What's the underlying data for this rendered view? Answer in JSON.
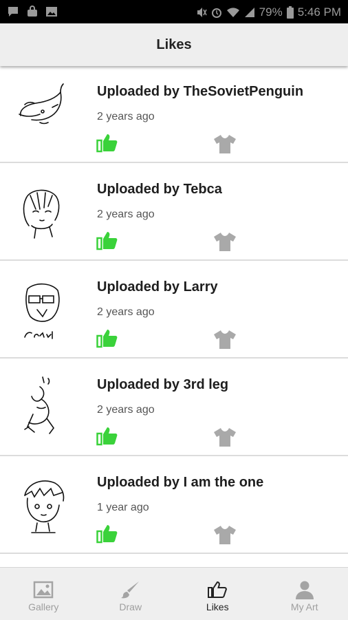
{
  "status_bar": {
    "battery": "79%",
    "time": "5:46 PM",
    "icons": [
      "chat-icon",
      "bag-icon",
      "image-icon",
      "mute-icon",
      "alarm-icon",
      "wifi-icon",
      "signal-icon",
      "battery-icon"
    ]
  },
  "header": {
    "title": "Likes"
  },
  "items": [
    {
      "uploader": "Uploaded by TheSovietPenguin",
      "ago": "2 years ago"
    },
    {
      "uploader": "Uploaded by Tebca",
      "ago": "2 years ago"
    },
    {
      "uploader": "Uploaded by Larry",
      "ago": "2 years ago"
    },
    {
      "uploader": "Uploaded by 3rd leg",
      "ago": "2 years ago"
    },
    {
      "uploader": "Uploaded by I am the one",
      "ago": "1 year ago"
    }
  ],
  "like_icon_color": "#3ad23a",
  "shirt_icon_color": "#a9a9a9",
  "bottom_nav": [
    {
      "label": "Gallery",
      "icon": "gallery-icon"
    },
    {
      "label": "Draw",
      "icon": "brush-icon"
    },
    {
      "label": "Likes",
      "icon": "thumbs-up-icon",
      "active": true
    },
    {
      "label": "My Art",
      "icon": "person-icon"
    }
  ]
}
